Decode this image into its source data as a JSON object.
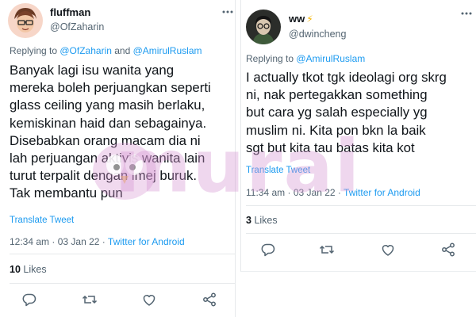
{
  "tweets": [
    {
      "display_name": "fluffman",
      "handle": "@OfZaharin",
      "reply_prefix": "Replying to ",
      "reply_mentions": [
        "@OfZaharin",
        "@AmirulRuslam"
      ],
      "reply_joiner": " and ",
      "body": "Banyak lagi isu wanita yang\nmereka boleh perjuangkan seperti\nglass ceiling yang masih berlaku,\nkemiskinan haid dan sebagainya.\nDisebabkan orang macam dia ni\nlah perjuangan aktivis wanita lain\nturut terpalit dengan imej buruk.\nTak membantu pun",
      "translate": "Translate Tweet",
      "time": "12:34 am",
      "date": "03 Jan 22",
      "dot": "·",
      "source": "Twitter for Android",
      "likes_count": "10",
      "likes_label": "Likes"
    },
    {
      "display_name": "ww",
      "name_emoji": "⚡",
      "handle": "@dwincheng",
      "reply_prefix": "Replying to ",
      "reply_mentions": [
        "@AmirulRuslam"
      ],
      "body": "I actually tkot tgk ideolagi org skrg\nni, nak pertegakkan something\nbut cara yg salah especially yg\nmuslim ni. Kita pon bkn la baik\nsgt but kita tau batas kita kot",
      "translate": "Translate Tweet",
      "time": "11:34 am",
      "date": "03 Jan 22",
      "dot": "·",
      "source": "Twitter for Android",
      "likes_count": "3",
      "likes_label": "Likes"
    }
  ],
  "watermark": "murai",
  "icons": [
    "more-icon",
    "reply-icon",
    "retweet-icon",
    "like-icon",
    "share-icon"
  ],
  "colors": {
    "link": "#1d9bf0",
    "secondary": "#536471",
    "text": "#0f1419",
    "watermark": "#d696d2"
  }
}
